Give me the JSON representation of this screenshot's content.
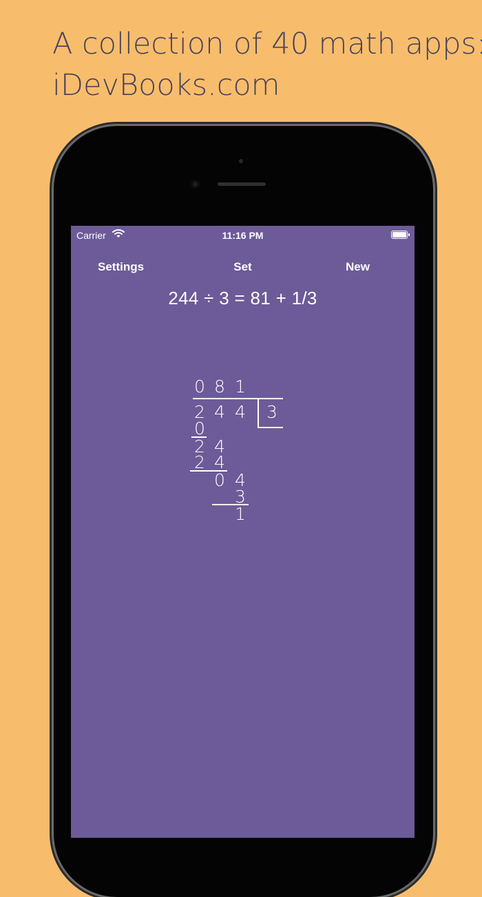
{
  "headline": {
    "line1": "A collection of 40 math apps:",
    "line2": "iDevBooks.com"
  },
  "status_bar": {
    "carrier": "Carrier",
    "time": "11:16 PM"
  },
  "nav": {
    "settings": "Settings",
    "set": "Set",
    "new": "New"
  },
  "equation": "244 ÷ 3 = 81 + 1/3",
  "long_division": {
    "quotient": [
      "0",
      "8",
      "1"
    ],
    "dividend": [
      "2",
      "4",
      "4"
    ],
    "divisor": "3",
    "step1_product": "0",
    "step2_partial": [
      "2",
      "4"
    ],
    "step2_product": [
      "2",
      "4"
    ],
    "step3_partial": [
      "0",
      "4"
    ],
    "step3_product": "3",
    "remainder": "1"
  },
  "colors": {
    "background": "#F8BD6C",
    "headline_text": "#4A4459",
    "screen": "#6C5B98",
    "phone_body": "#040404"
  }
}
